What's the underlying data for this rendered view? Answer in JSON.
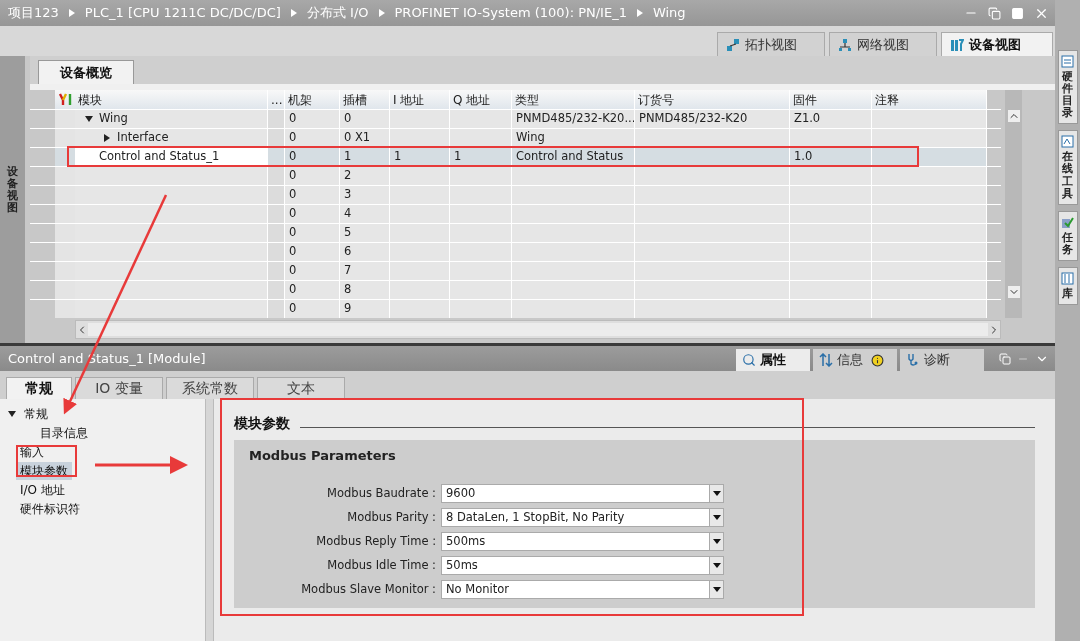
{
  "breadcrumb": [
    "项目123",
    "PLC_1 [CPU 1211C DC/DC/DC]",
    "分布式 I/O",
    "PROFINET IO-System (100): PN/IE_1",
    "Wing"
  ],
  "view_tabs": [
    {
      "label": "拓扑视图",
      "kind": "topology",
      "selected": false
    },
    {
      "label": "网络视图",
      "kind": "network",
      "selected": false
    },
    {
      "label": "设备视图",
      "kind": "device",
      "selected": true
    }
  ],
  "left_strip": {
    "label": "设备视图"
  },
  "right_strip": [
    {
      "label": "硬件目录",
      "kind": "catalog"
    },
    {
      "label": "在线工具",
      "kind": "online"
    },
    {
      "label": "任务",
      "kind": "tasks"
    },
    {
      "label": "库",
      "kind": "library"
    }
  ],
  "overview_tab": {
    "label": "设备概览",
    "selected": true
  },
  "table": {
    "columns": [
      "模块",
      "...",
      "机架",
      "插槽",
      "I 地址",
      "Q 地址",
      "类型",
      "订货号",
      "固件",
      "注释"
    ],
    "rows": [
      {
        "module": "Wing",
        "expanded": true,
        "selected": false,
        "rack": "0",
        "slot": "0",
        "type": "PNMD485/232-K20...",
        "order_no": "PNMD485/232-K20",
        "firmware": "Z1.0",
        "children": [
          {
            "module": "Interface",
            "expanded": false,
            "selected": false,
            "rack": "0",
            "slot": "0 X1",
            "type": "Wing"
          }
        ]
      },
      {
        "module": "Control and Status_1",
        "selected": true,
        "rack": "0",
        "slot": "1",
        "i_addr": "1",
        "q_addr": "1",
        "type": "Control and Status",
        "firmware": "1.0"
      },
      {
        "selected": false,
        "rack": "0",
        "slot": "2"
      },
      {
        "selected": false,
        "rack": "0",
        "slot": "3"
      },
      {
        "selected": false,
        "rack": "0",
        "slot": "4"
      },
      {
        "selected": false,
        "rack": "0",
        "slot": "5"
      },
      {
        "selected": false,
        "rack": "0",
        "slot": "6"
      },
      {
        "selected": false,
        "rack": "0",
        "slot": "7"
      },
      {
        "selected": false,
        "rack": "0",
        "slot": "8"
      },
      {
        "selected": false,
        "rack": "0",
        "slot": "9"
      }
    ]
  },
  "properties": {
    "title": "Control and Status_1 [Module]",
    "panel_tabs": [
      {
        "label": "属性",
        "kind": "properties",
        "selected": true
      },
      {
        "label": "信息",
        "kind": "info",
        "selected": false
      },
      {
        "label": "诊断",
        "kind": "diagnostics",
        "selected": false
      }
    ],
    "tabs": [
      {
        "label": "常规",
        "selected": true
      },
      {
        "label": "IO 变量",
        "selected": false
      },
      {
        "label": "系统常数",
        "selected": false
      },
      {
        "label": "文本",
        "selected": false
      }
    ],
    "nav": [
      {
        "label": "常规",
        "expanded": true,
        "selected": false,
        "children": [
          {
            "label": "目录信息",
            "selected": false
          }
        ]
      },
      {
        "label": "输入",
        "selected": false
      },
      {
        "label": "模块参数",
        "selected": true
      },
      {
        "label": "I/O 地址",
        "selected": false
      },
      {
        "label": "硬件标识符",
        "selected": false
      }
    ],
    "section_title": "模块参数",
    "group_title": "Modbus Parameters",
    "params": [
      {
        "label": "Modbus Baudrate :",
        "value": "9600"
      },
      {
        "label": "Modbus Parity :",
        "value": "8 DataLen, 1 StopBit, No Parity"
      },
      {
        "label": "Modbus Reply Time :",
        "value": "500ms"
      },
      {
        "label": "Modbus Idle Time :",
        "value": "50ms"
      },
      {
        "label": "Modbus Slave Monitor :",
        "value": "No Monitor"
      }
    ]
  }
}
